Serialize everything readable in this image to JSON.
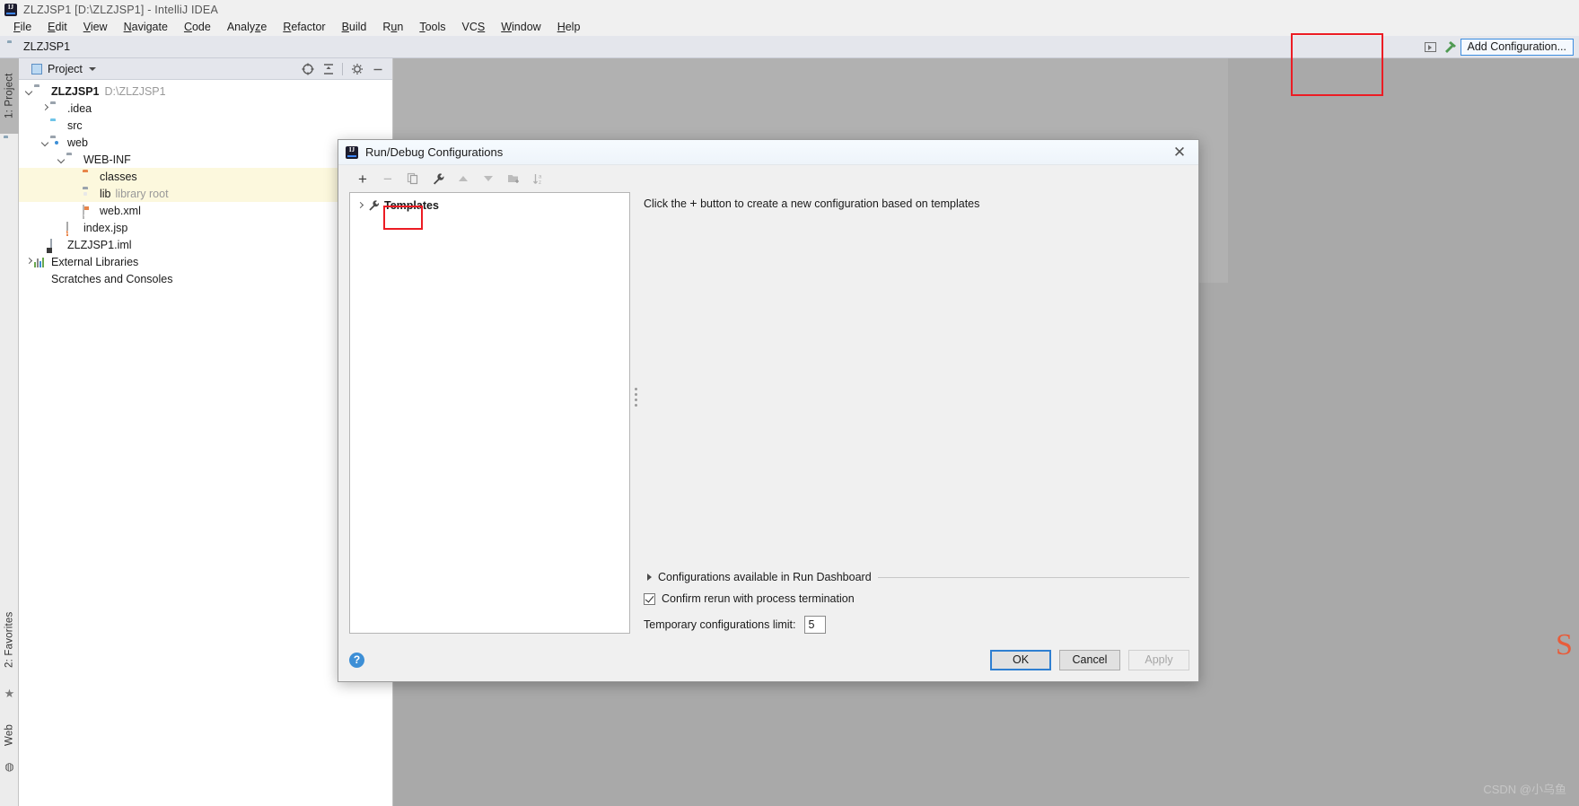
{
  "window": {
    "title": "ZLZJSP1 [D:\\ZLZJSP1] - IntelliJ IDEA",
    "logo_icon": "intellij-idea-logo-icon"
  },
  "menubar": {
    "items": [
      {
        "label": "File"
      },
      {
        "label": "Edit"
      },
      {
        "label": "View"
      },
      {
        "label": "Navigate"
      },
      {
        "label": "Code"
      },
      {
        "label": "Analyze"
      },
      {
        "label": "Refactor"
      },
      {
        "label": "Build"
      },
      {
        "label": "Run"
      },
      {
        "label": "Tools"
      },
      {
        "label": "VCS"
      },
      {
        "label": "Window"
      },
      {
        "label": "Help"
      }
    ]
  },
  "navbar": {
    "breadcrumb": "ZLZJSP1",
    "run_icon": "run-icon",
    "build_icon": "hammer-build-icon",
    "add_configuration_label": "Add Configuration..."
  },
  "left_strip": {
    "project_label": "1: Project",
    "project_icon": "project-folder-icon",
    "favorites_label": "2: Favorites",
    "favorites_icon": "star-icon",
    "web_label": "Web",
    "web_icon": "globe-icon"
  },
  "project_panel": {
    "title": "Project",
    "view_icon": "project-view-icon",
    "dropdown_icon": "chevron-down-icon",
    "locate_icon": "scroll-from-source-icon",
    "collapse_icon": "collapse-all-icon",
    "settings_icon": "gear-icon",
    "hide_icon": "minimize-icon",
    "tree": [
      {
        "label": "ZLZJSP1",
        "sub": "D:\\ZLZJSP1",
        "icon": "module-folder-icon",
        "indent": 0,
        "arrow": "down",
        "bold": true,
        "highlight": false
      },
      {
        "label": ".idea",
        "sub": "",
        "icon": "folder-grey-icon",
        "indent": 1,
        "arrow": "right",
        "bold": false,
        "highlight": false
      },
      {
        "label": "src",
        "sub": "",
        "icon": "folder-source-icon",
        "indent": 1,
        "arrow": "none",
        "bold": false,
        "highlight": false
      },
      {
        "label": "web",
        "sub": "",
        "icon": "folder-web-icon",
        "indent": 1,
        "arrow": "down",
        "bold": false,
        "highlight": false
      },
      {
        "label": "WEB-INF",
        "sub": "",
        "icon": "folder-grey-icon",
        "indent": 2,
        "arrow": "down",
        "bold": false,
        "highlight": false
      },
      {
        "label": "classes",
        "sub": "",
        "icon": "folder-output-icon",
        "indent": 3,
        "arrow": "none",
        "bold": false,
        "highlight": true
      },
      {
        "label": "lib",
        "sub": "library root",
        "icon": "folder-library-icon",
        "indent": 3,
        "arrow": "none",
        "bold": false,
        "highlight": true
      },
      {
        "label": "web.xml",
        "sub": "",
        "icon": "xml-file-icon",
        "indent": 3,
        "arrow": "none",
        "bold": false,
        "highlight": false
      },
      {
        "label": "index.jsp",
        "sub": "",
        "icon": "jsp-file-icon",
        "indent": 2,
        "arrow": "none",
        "bold": false,
        "highlight": false
      },
      {
        "label": "ZLZJSP1.iml",
        "sub": "",
        "icon": "iml-file-icon",
        "indent": 1,
        "arrow": "none",
        "bold": false,
        "highlight": false
      },
      {
        "label": "External Libraries",
        "sub": "",
        "icon": "external-libraries-icon",
        "indent": 0,
        "arrow": "right",
        "bold": false,
        "highlight": false
      },
      {
        "label": "Scratches and Consoles",
        "sub": "",
        "icon": "scratches-icon",
        "indent": 0,
        "arrow": "none",
        "bold": false,
        "highlight": false
      }
    ]
  },
  "dialog": {
    "title": "Run/Debug Configurations",
    "title_icon": "intellij-idea-logo-icon",
    "close_icon": "close-icon",
    "toolbar": [
      {
        "name": "add-configuration-button",
        "icon": "plus-icon",
        "label": "+",
        "enabled": true
      },
      {
        "name": "remove-configuration-button",
        "icon": "minus-icon",
        "label": "−",
        "enabled": false
      },
      {
        "name": "copy-configuration-button",
        "icon": "copy-icon",
        "label": "",
        "enabled": false
      },
      {
        "name": "edit-templates-button",
        "icon": "wrench-icon",
        "label": "",
        "enabled": true
      },
      {
        "name": "move-up-button",
        "icon": "arrow-up-icon",
        "label": "",
        "enabled": false
      },
      {
        "name": "move-down-button",
        "icon": "arrow-down-icon",
        "label": "",
        "enabled": false
      },
      {
        "name": "create-folder-button",
        "icon": "new-folder-icon",
        "label": "",
        "enabled": false
      },
      {
        "name": "sort-configurations-button",
        "icon": "sort-alphabetically-icon",
        "label": "",
        "enabled": false
      }
    ],
    "tree": {
      "templates_label": "Templates",
      "templates_icon": "wrench-icon",
      "expand_icon": "chevron-right-icon"
    },
    "hint": {
      "prefix": "Click the ",
      "plus": "+",
      "suffix": " button to create a new configuration based on templates"
    },
    "run_dashboard_label": "Configurations available in Run Dashboard",
    "run_dashboard_expand_icon": "triangle-right-icon",
    "confirm_rerun_label": "Confirm rerun with process termination",
    "confirm_rerun_checked": true,
    "temp_limit_label": "Temporary configurations limit:",
    "temp_limit_value": "5",
    "help_label": "?",
    "buttons": {
      "ok": "OK",
      "cancel": "Cancel",
      "apply": "Apply"
    }
  },
  "watermark": {
    "text": "CSDN @小乌鱼"
  },
  "colors": {
    "accent_blue": "#3d8fd6",
    "highlight_row": "#fcf8dd",
    "annotation_red": "#ec1c24",
    "editor_bg": "#a9a9a9"
  }
}
